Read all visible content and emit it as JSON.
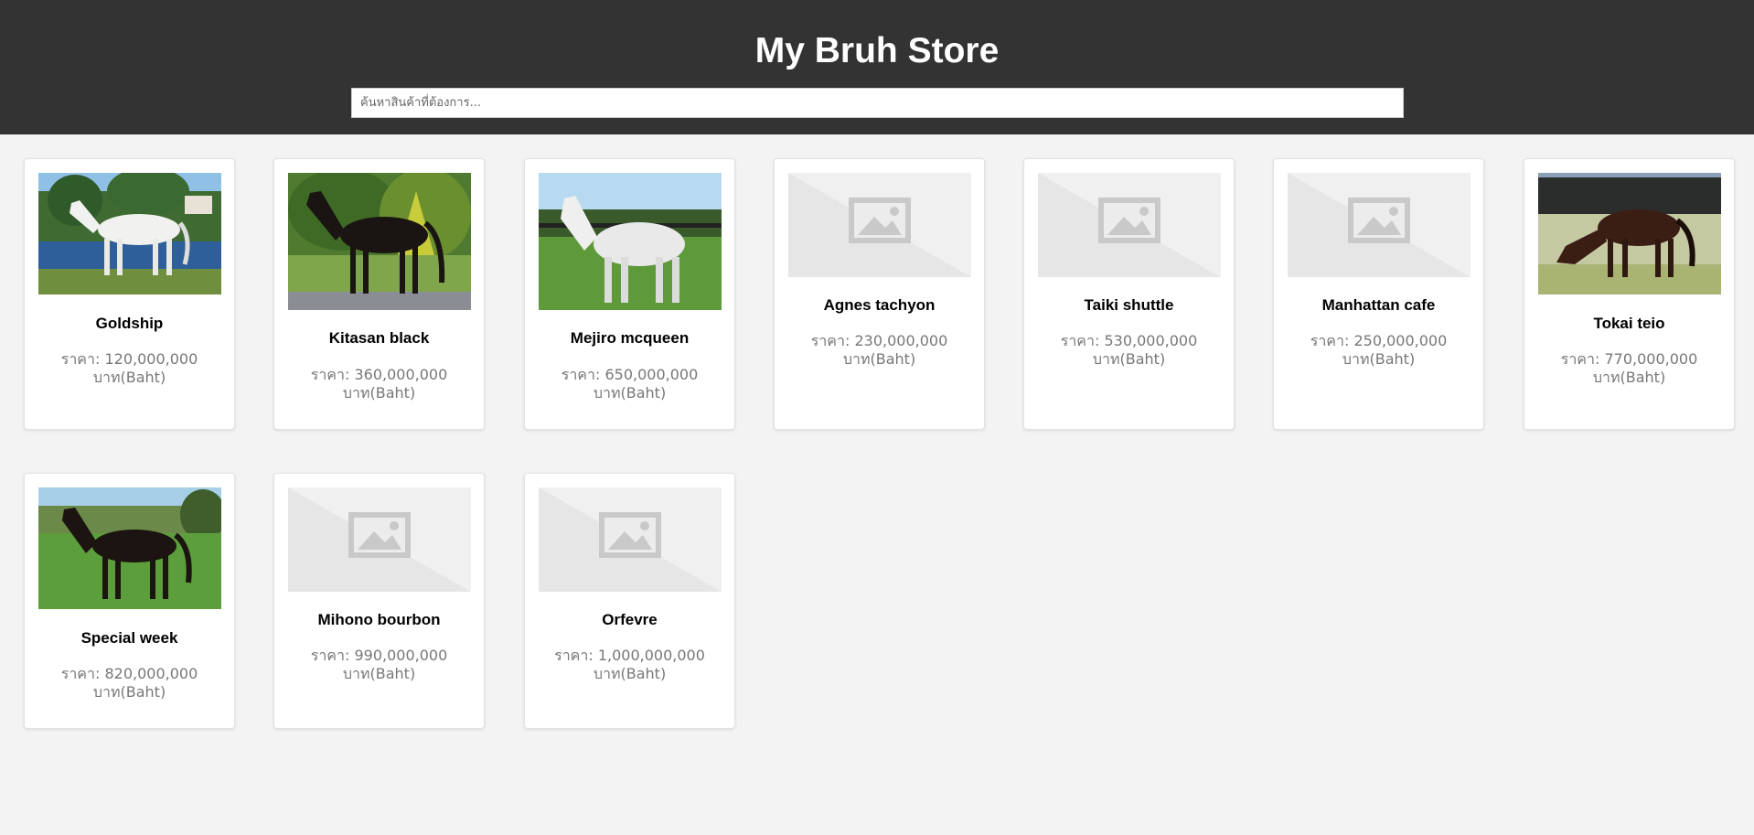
{
  "header": {
    "title": "My Bruh Store",
    "search_placeholder": "ค้นหาสินค้าที่ต้องการ...",
    "background": "#333333"
  },
  "price_label": "ราคา:",
  "currency_label": "บาท(Baht)",
  "products": [
    {
      "name": "Goldship",
      "price": "120,000,000",
      "image": "grey-horse-by-pond-photo"
    },
    {
      "name": "Kitasan black",
      "price": "360,000,000",
      "image": "dark-bay-horse-photo"
    },
    {
      "name": "Mejiro mcqueen",
      "price": "650,000,000",
      "image": "grey-horse-in-paddock-photo"
    },
    {
      "name": "Agnes tachyon",
      "price": "230,000,000",
      "image": "image-placeholder-icon"
    },
    {
      "name": "Taiki shuttle",
      "price": "530,000,000",
      "image": "image-placeholder-icon"
    },
    {
      "name": "Manhattan cafe",
      "price": "250,000,000",
      "image": "image-placeholder-icon"
    },
    {
      "name": "Tokai teio",
      "price": "770,000,000",
      "image": "bay-horse-grazing-photo"
    },
    {
      "name": "Special week",
      "price": "820,000,000",
      "image": "dark-bay-horse-on-grass-photo"
    },
    {
      "name": "Mihono bourbon",
      "price": "990,000,000",
      "image": "image-placeholder-icon"
    },
    {
      "name": "Orfevre",
      "price": "1,000,000,000",
      "image": "image-placeholder-icon"
    }
  ]
}
